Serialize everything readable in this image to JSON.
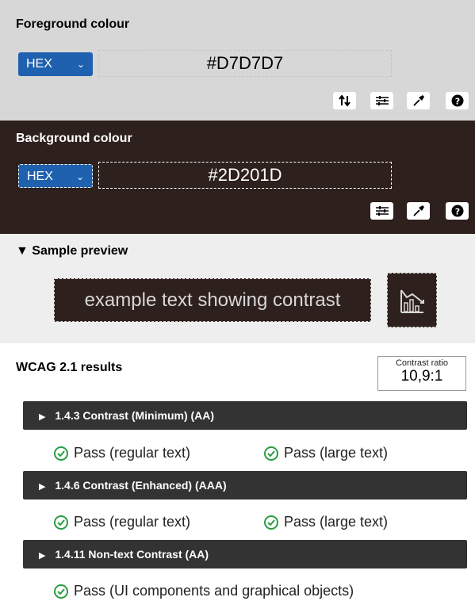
{
  "foreground": {
    "title": "Foreground colour",
    "format": "HEX",
    "value": "#D7D7D7",
    "panel_color": "#d7d7d7",
    "tools": [
      "swap-icon",
      "sliders-icon",
      "eyedropper-icon",
      "help-icon"
    ]
  },
  "background": {
    "title": "Background colour",
    "format": "HEX",
    "value": "#2D201D",
    "panel_color": "#2d201d",
    "tools": [
      "sliders-icon",
      "eyedropper-icon",
      "help-icon"
    ]
  },
  "sample": {
    "title": "Sample preview",
    "text": "example text showing contrast",
    "icon": "chart-icon"
  },
  "results": {
    "title": "WCAG 2.1 results",
    "ratio_label": "Contrast ratio",
    "ratio_value": "10,9:1",
    "criteria": [
      {
        "label": "1.4.3 Contrast (Minimum) (AA)",
        "results": [
          "Pass (regular text)",
          "Pass (large text)"
        ]
      },
      {
        "label": "1.4.6 Contrast (Enhanced) (AAA)",
        "results": [
          "Pass (regular text)",
          "Pass (large text)"
        ]
      },
      {
        "label": "1.4.11 Non-text Contrast (AA)",
        "results": [
          "Pass (UI components and graphical objects)"
        ]
      }
    ]
  },
  "colors": {
    "accent": "#1f61ae",
    "pass": "#2a9d44",
    "criterion_bg": "#333333"
  }
}
